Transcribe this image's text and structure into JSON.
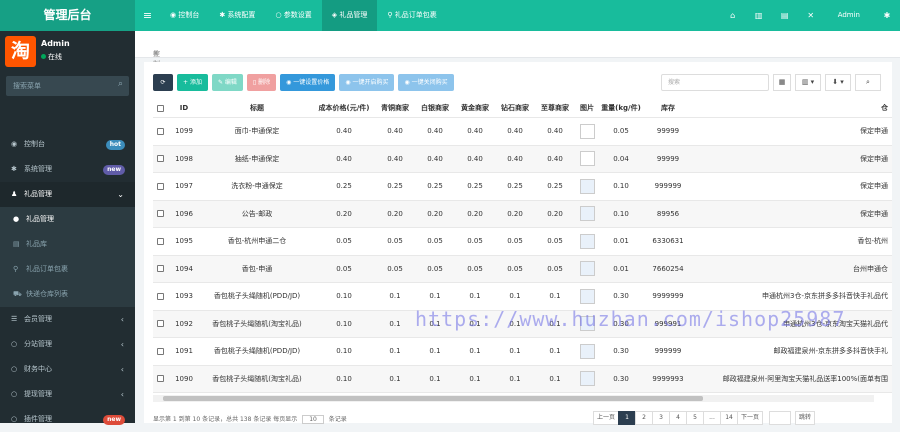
{
  "app": {
    "title": "管理后台"
  },
  "topnav": {
    "items": [
      {
        "icon": "dashboard-icon",
        "label": "控制台"
      },
      {
        "icon": "gear-icon",
        "label": "系统配置"
      },
      {
        "icon": "circle-icon",
        "label": "参数设置"
      },
      {
        "icon": "gift-icon",
        "label": "礼品管理"
      },
      {
        "icon": "pin-icon",
        "label": "礼品订单包裹"
      }
    ],
    "admin": "Admin"
  },
  "user": {
    "name": "Admin",
    "status": "在线",
    "avatar_text": "淘"
  },
  "sidebar": {
    "search_placeholder": "搜索菜单",
    "items": [
      {
        "label": "控制台",
        "badge": "hot"
      },
      {
        "label": "系统管理",
        "badge": "new"
      },
      {
        "label": "礼品管理"
      },
      {
        "label": "礼品管理"
      },
      {
        "label": "礼品库"
      },
      {
        "label": "礼品订单包裹"
      },
      {
        "label": "快递仓库列表"
      },
      {
        "label": "会员管理"
      },
      {
        "label": "分站管理"
      },
      {
        "label": "财务中心"
      },
      {
        "label": "提现管理"
      },
      {
        "label": "插件管理",
        "badge": "new"
      }
    ]
  },
  "breadcrumb": "控制台",
  "toolbar": {
    "add": "添加",
    "edit": "编辑",
    "delete": "删除",
    "set_price": "一键设置价格",
    "enable": "一键开启购买",
    "disable": "一键关闭购买",
    "search_placeholder": "搜索"
  },
  "table": {
    "headers": [
      "ID",
      "标题",
      "成本价格(元/件)",
      "青铜商家",
      "白银商家",
      "黄金商家",
      "钻石商家",
      "至尊商家",
      "图片",
      "重量(kg/件)",
      "库存",
      "仓"
    ],
    "rows": [
      {
        "id": "1099",
        "title": "面巾-申通保定",
        "cost": "0.40",
        "v1": "0.40",
        "v2": "0.40",
        "v3": "0.40",
        "v4": "0.40",
        "v5": "0.40",
        "weight": "0.05",
        "stock": "99999",
        "wh": "保定申通"
      },
      {
        "id": "1098",
        "title": "抽纸-申通保定",
        "cost": "0.40",
        "v1": "0.40",
        "v2": "0.40",
        "v3": "0.40",
        "v4": "0.40",
        "v5": "0.40",
        "weight": "0.04",
        "stock": "99999",
        "wh": "保定申通"
      },
      {
        "id": "1097",
        "title": "洗衣粉-申通保定",
        "cost": "0.25",
        "v1": "0.25",
        "v2": "0.25",
        "v3": "0.25",
        "v4": "0.25",
        "v5": "0.25",
        "weight": "0.10",
        "stock": "999999",
        "wh": "保定申通"
      },
      {
        "id": "1096",
        "title": "公告-邮政",
        "cost": "0.20",
        "v1": "0.20",
        "v2": "0.20",
        "v3": "0.20",
        "v4": "0.20",
        "v5": "0.20",
        "weight": "0.10",
        "stock": "89956",
        "wh": "保定申通"
      },
      {
        "id": "1095",
        "title": "香包-杭州申通二仓",
        "cost": "0.05",
        "v1": "0.05",
        "v2": "0.05",
        "v3": "0.05",
        "v4": "0.05",
        "v5": "0.05",
        "weight": "0.01",
        "stock": "6330631",
        "wh": "香包-杭州"
      },
      {
        "id": "1094",
        "title": "香包-申通",
        "cost": "0.05",
        "v1": "0.05",
        "v2": "0.05",
        "v3": "0.05",
        "v4": "0.05",
        "v5": "0.05",
        "weight": "0.01",
        "stock": "7660254",
        "wh": "台州申通仓"
      },
      {
        "id": "1093",
        "title": "香包桃子头绳随机(PDD/JD)",
        "cost": "0.10",
        "v1": "0.1",
        "v2": "0.1",
        "v3": "0.1",
        "v4": "0.1",
        "v5": "0.1",
        "weight": "0.30",
        "stock": "9999999",
        "wh": "申通杭州3仓-京东拼多多抖音快手礼品代"
      },
      {
        "id": "1092",
        "title": "香包桃子头绳随机(淘宝礼品)",
        "cost": "0.10",
        "v1": "0.1",
        "v2": "0.1",
        "v3": "0.1",
        "v4": "0.1",
        "v5": "0.1",
        "weight": "0.30",
        "stock": "999991",
        "wh": "申通杭州3仓-京东淘宝天猫礼品代"
      },
      {
        "id": "1091",
        "title": "香包桃子头绳随机(PDD/JD)",
        "cost": "0.10",
        "v1": "0.1",
        "v2": "0.1",
        "v3": "0.1",
        "v4": "0.1",
        "v5": "0.1",
        "weight": "0.30",
        "stock": "999999",
        "wh": "邮政福建泉州-京东拼多多抖音快手礼"
      },
      {
        "id": "1090",
        "title": "香包桃子头绳随机(淘宝礼品)",
        "cost": "0.10",
        "v1": "0.1",
        "v2": "0.1",
        "v3": "0.1",
        "v4": "0.1",
        "v5": "0.1",
        "weight": "0.30",
        "stock": "9999993",
        "wh": "邮政福建泉州-阿里淘宝天猫礼品送率100%(面单有围"
      }
    ]
  },
  "footer": {
    "summary": "显示第 1 到第 10 条记录，总共 138 条记录 每页显示",
    "page_size": "10",
    "suffix": "条记录"
  },
  "pager": {
    "prev": "上一页",
    "pages": [
      "1",
      "2",
      "3",
      "4",
      "5",
      "...",
      "14"
    ],
    "next": "下一页",
    "jump": "跳转"
  },
  "watermark": "https://www.huzhan.com/ishop25987"
}
